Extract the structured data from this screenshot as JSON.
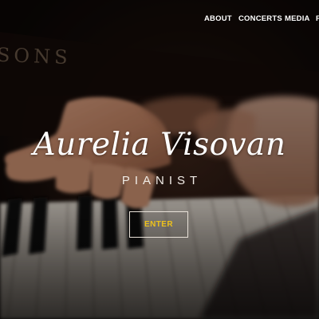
{
  "nav": {
    "items": [
      {
        "label": "ABOUT"
      },
      {
        "label": "CONCERTS"
      },
      {
        "label": "MEDIA"
      }
    ],
    "overflow_label": "R"
  },
  "hero": {
    "title": "Aurelia Visovan",
    "subtitle": "PIANIST",
    "enter_label": "ENTER"
  },
  "background": {
    "piano_brand_text": "SONS",
    "colors": {
      "dark": "#0d0807",
      "skin": "#c79074",
      "accent": "#ecc11c"
    }
  }
}
